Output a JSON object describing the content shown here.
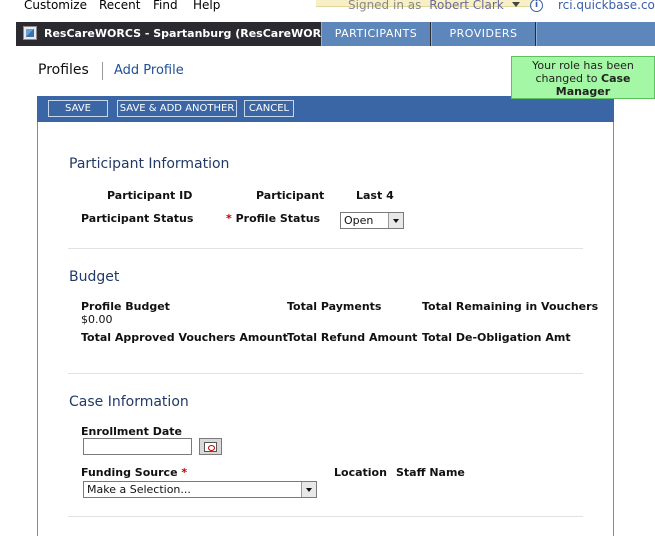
{
  "menu": {
    "items": [
      "Customize",
      "Recent",
      "Find",
      "Help"
    ],
    "signed_in_label": "Signed in as",
    "user_name": "Robert Clark",
    "realm": "rci.quickbase.com"
  },
  "app": {
    "title": "ResCareWORCS - Spartanburg (ResCareWORCS)",
    "tabs": [
      "PARTICIPANTS",
      "PROVIDERS"
    ]
  },
  "page": {
    "title": "Profiles",
    "add_link": "Add Profile",
    "role_notice": {
      "line1": "Your role has been",
      "line2": "changed to",
      "role": "Case",
      "line3": "Manager"
    }
  },
  "buttons": {
    "save": "SAVE",
    "save_add": "SAVE & ADD ANOTHER",
    "cancel": "CANCEL"
  },
  "participant_info": {
    "title": "Participant Information",
    "participant_id_label": "Participant ID",
    "participant_label": "Participant",
    "last4_label": "Last 4",
    "status_label": "Participant Status",
    "profile_status_label": "Profile Status",
    "required_mark": "*",
    "profile_status_value": "Open"
  },
  "budget": {
    "title": "Budget",
    "profile_budget_label": "Profile Budget",
    "profile_budget_value": "$0.00",
    "total_payments_label": "Total Payments",
    "total_remaining_label": "Total Remaining in Vouchers",
    "total_approved_label": "Total Approved Vouchers Amount",
    "total_refund_label": "Total Refund Amount",
    "total_deobligation_label": "Total De-Obligation Amt"
  },
  "case_info": {
    "title": "Case Information",
    "enrollment_date_label": "Enrollment Date",
    "enrollment_date_value": "",
    "funding_source_label": "Funding Source",
    "required_mark": "*",
    "funding_source_value": "Make a Selection...",
    "location_label": "Location",
    "staff_name_label": "Staff Name"
  }
}
